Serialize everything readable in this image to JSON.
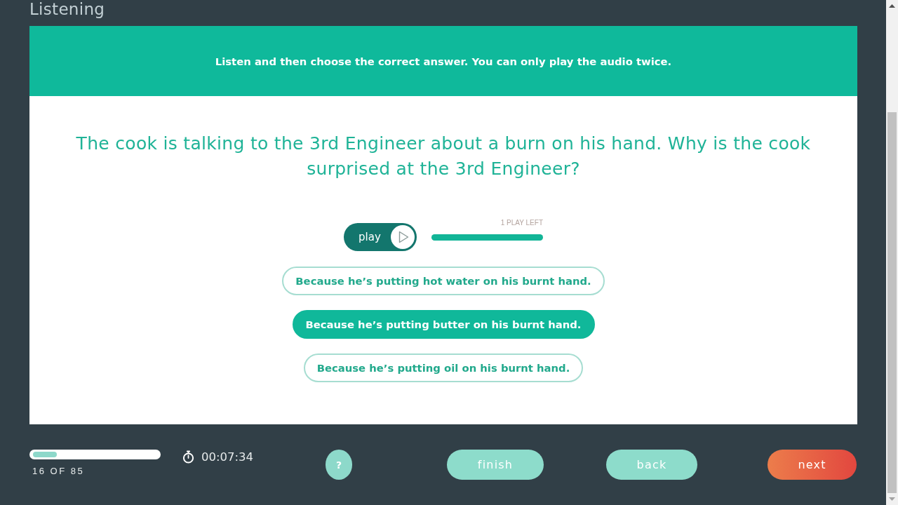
{
  "page": {
    "title": "Listening"
  },
  "instruction_banner": {
    "text": "Listen and then choose the correct answer. You can only play the audio twice."
  },
  "question": {
    "text": "The cook is talking to the 3rd Engineer about a burn on his hand. Why is the cook surprised at the 3rd Engineer?"
  },
  "audio_player": {
    "button_label": "play",
    "plays_left": "1 PLAY LEFT",
    "level": 1
  },
  "answers": [
    {
      "text": "Because he’s putting hot water on his burnt hand.",
      "selected": false
    },
    {
      "text": "Because he’s putting butter on his burnt hand.",
      "selected": true
    },
    {
      "text": "Because he’s putting oil on his burnt hand.",
      "selected": false
    }
  ],
  "footer": {
    "progress": {
      "level": 0.19,
      "label": "16 OF 85"
    },
    "timer": "00:07:34",
    "buttons": [
      {
        "label": "?",
        "kind": "help"
      },
      {
        "label": "finish",
        "kind": "finish"
      },
      {
        "label": "back",
        "kind": "back"
      },
      {
        "label": "next",
        "kind": "next"
      }
    ]
  }
}
